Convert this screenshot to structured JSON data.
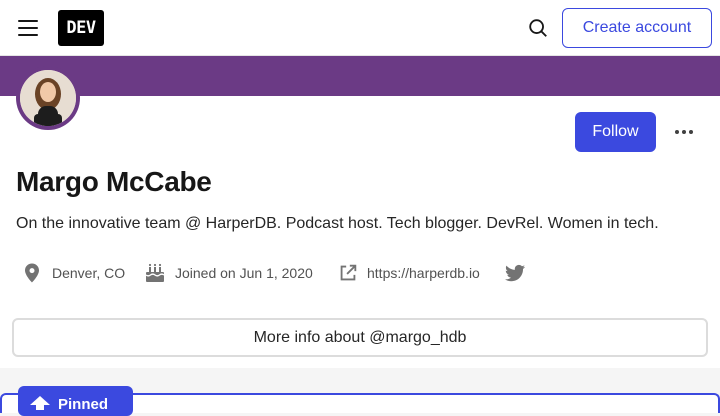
{
  "header": {
    "logo_text": "DEV",
    "create_account_label": "Create account"
  },
  "profile": {
    "name": "Margo McCabe",
    "bio": "On the innovative team @ HarperDB. Podcast host. Tech blogger. DevRel. Women in tech.",
    "follow_label": "Follow",
    "location": "Denver, CO",
    "joined": "Joined on Jun 1, 2020",
    "website": "https://harperdb.io",
    "more_info_label": "More info about @margo_hdb"
  },
  "pinned": {
    "label": "Pinned"
  },
  "colors": {
    "brand_accent": "#3b49df",
    "profile_banner": "#6b3a85"
  },
  "icons": {
    "menu": "hamburger-menu-icon",
    "search": "search-icon",
    "more": "more-horizontal-icon",
    "location": "location-pin-icon",
    "joined": "cake-icon",
    "website": "external-link-icon",
    "twitter": "twitter-icon",
    "pinned": "pin-icon"
  }
}
